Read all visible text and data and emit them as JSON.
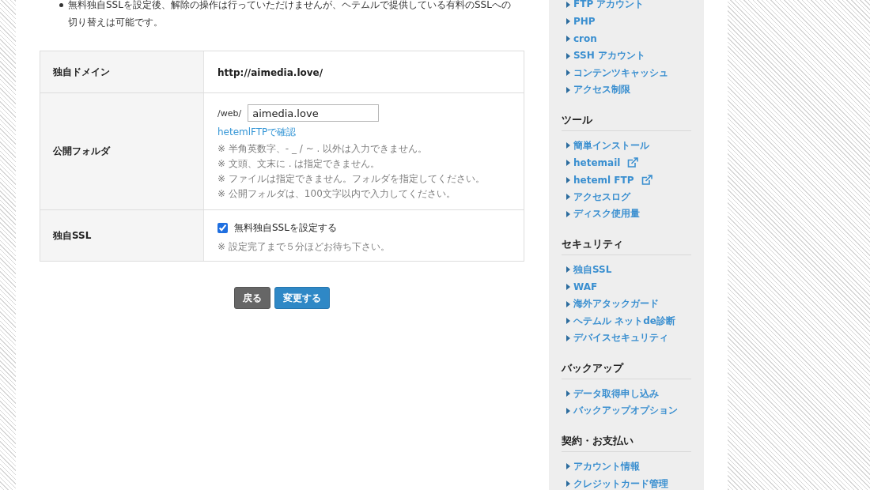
{
  "notice": {
    "items": [
      "無料独自SSLを設定後、解除の操作は行っていただけませんが、ヘテムルで提供している有料のSSLへの切り替えは可能です。"
    ]
  },
  "form": {
    "rows": [
      {
        "kind": "text",
        "label": "独自ドメイン",
        "value": "http://aimedia.love/"
      },
      {
        "kind": "folder",
        "label": "公開フォルダ",
        "prefix": "/web/",
        "value": "aimedia.love",
        "link": "hetemlFTPで確認",
        "notes": [
          "※ 半角英数字、- _ / ~ . 以外は入力できません。",
          "※ 文頭、文末に . は指定できません。",
          "※ ファイルは指定できません。フォルダを指定してください。",
          "※ 公開フォルダは、100文字以内で入力してください。"
        ]
      },
      {
        "kind": "checkbox",
        "label": "独自SSL",
        "option": "無料独自SSLを設定する",
        "checked": true,
        "notes": [
          "※ 設定完了まで５分ほどお待ち下さい。"
        ]
      }
    ]
  },
  "buttons": [
    {
      "kind": "secondary",
      "label": "戻る"
    },
    {
      "kind": "primary",
      "label": "変更する"
    }
  ],
  "sidebar": {
    "sections": [
      {
        "items": [
          {
            "label": "FTP アカウント",
            "external": false
          },
          {
            "label": "PHP",
            "external": false
          },
          {
            "label": "cron",
            "external": false
          },
          {
            "label": "SSH アカウント",
            "external": false
          },
          {
            "label": "コンテンツキャッシュ",
            "external": false
          },
          {
            "label": "アクセス制限",
            "external": false
          }
        ]
      },
      {
        "heading": "ツール",
        "items": [
          {
            "label": "簡単インストール",
            "external": false
          },
          {
            "label": "hetemail",
            "external": true
          },
          {
            "label": "heteml FTP",
            "external": true
          },
          {
            "label": "アクセスログ",
            "external": false
          },
          {
            "label": "ディスク使用量",
            "external": false
          }
        ]
      },
      {
        "heading": "セキュリティ",
        "items": [
          {
            "label": "独自SSL",
            "external": false
          },
          {
            "label": "WAF",
            "external": false
          },
          {
            "label": "海外アタックガード",
            "external": false
          },
          {
            "label": "ヘテムル ネットde診断",
            "external": false
          },
          {
            "label": "デバイスセキュリティ",
            "external": false
          }
        ]
      },
      {
        "heading": "バックアップ",
        "items": [
          {
            "label": "データ取得申し込み",
            "external": false
          },
          {
            "label": "バックアップオプション",
            "external": false
          }
        ]
      },
      {
        "heading": "契約・お支払い",
        "items": [
          {
            "label": "アカウント情報",
            "external": false
          },
          {
            "label": "クレジットカード管理",
            "external": false
          }
        ]
      }
    ]
  }
}
